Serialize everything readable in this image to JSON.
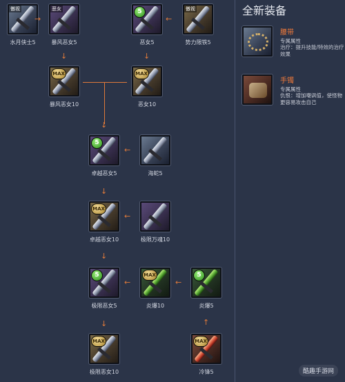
{
  "panel": {
    "title": "全新装备",
    "items": [
      {
        "name": "腰带",
        "sub": "专属属性",
        "desc": "治疗：提升技能/特效的治疗效果"
      },
      {
        "name": "手镯",
        "sub": "专属属性",
        "desc": "仇恨：增加嘲讽值，使怪物更容易攻击自己"
      }
    ]
  },
  "nodes": {
    "n1": {
      "label": "水月侠士5",
      "tag": "傲视"
    },
    "n2": {
      "label": "暴风恶女5",
      "tag": "恶女"
    },
    "n3": {
      "label": "恶女5",
      "badge": "5"
    },
    "n4": {
      "label": "势力限铁5",
      "tag": "傲视"
    },
    "n5": {
      "label": "暴风恶女10",
      "badge": "MAX"
    },
    "n6": {
      "label": "恶女10",
      "badge": "MAX"
    },
    "n7": {
      "label": "卓越恶女5",
      "badge": "5"
    },
    "n8": {
      "label": "海蛇5"
    },
    "n9": {
      "label": "卓越恶女10",
      "badge": "MAX"
    },
    "n10": {
      "label": "极限万魂10"
    },
    "n11": {
      "label": "极限恶女5",
      "badge": "5"
    },
    "n12": {
      "label": "炎爆10",
      "badge": "MAX"
    },
    "n13": {
      "label": "炎爆5",
      "badge": "5"
    },
    "n14": {
      "label": "极限恶女10",
      "badge": "MAX"
    },
    "n15": {
      "label": "冷锋5",
      "badge": "MAX"
    }
  },
  "watermark": "酷趣手游网",
  "colors": {
    "background": "#2b3448",
    "arrow": "#e07a3a",
    "accent_name": "#f07a3a"
  }
}
